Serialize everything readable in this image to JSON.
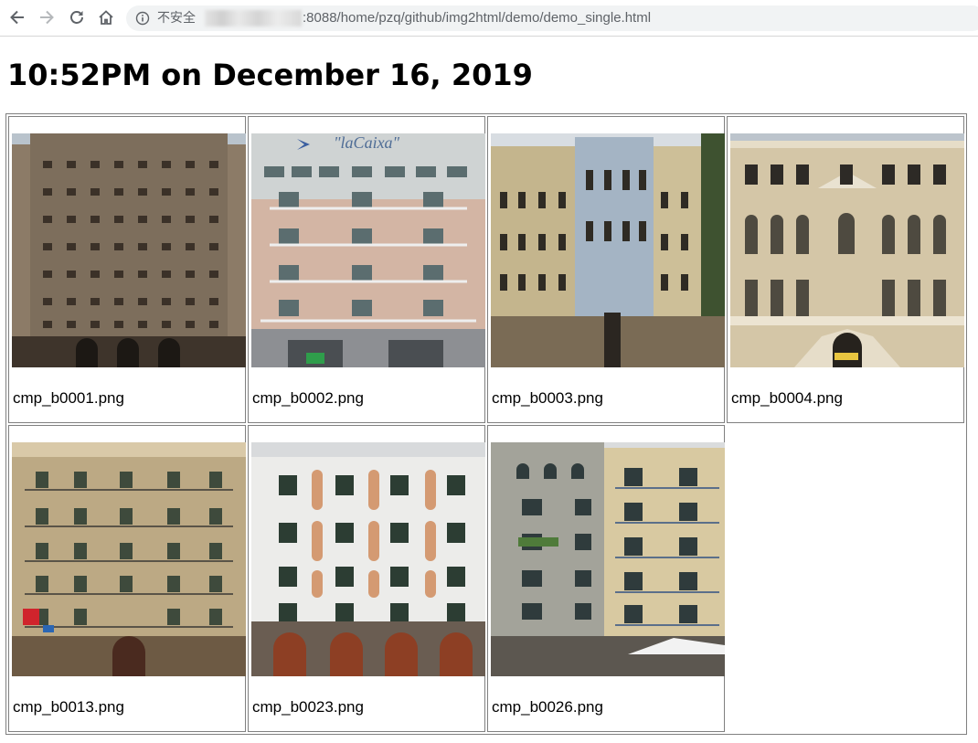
{
  "browser": {
    "security_label": "不安全",
    "url_path": ":8088/home/pzq/github/img2html/demo/demo_single.html",
    "icons": [
      "back-arrow-icon",
      "forward-arrow-icon",
      "reload-icon",
      "home-icon",
      "info-icon"
    ]
  },
  "page": {
    "title": "10:52PM on December 16, 2019"
  },
  "gallery": {
    "rows": [
      [
        {
          "caption": "cmp_b0001.png",
          "image": "building-photo"
        },
        {
          "caption": "cmp_b0002.png",
          "image": "building-photo"
        },
        {
          "caption": "cmp_b0003.png",
          "image": "building-photo"
        },
        {
          "caption": "cmp_b0004.png",
          "image": "building-photo"
        }
      ],
      [
        {
          "caption": "cmp_b0013.png",
          "image": "building-photo"
        },
        {
          "caption": "cmp_b0023.png",
          "image": "building-photo"
        },
        {
          "caption": "cmp_b0026.png",
          "image": "building-photo"
        }
      ]
    ]
  }
}
